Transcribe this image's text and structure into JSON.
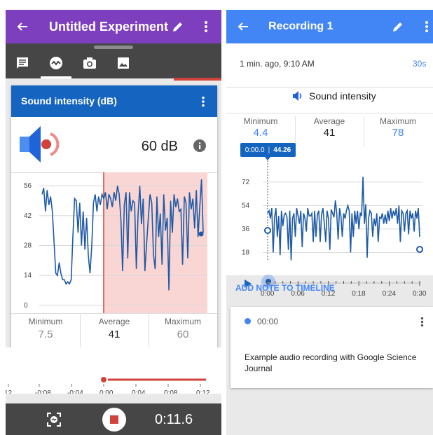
{
  "left_panel": {
    "title": "Untitled Experiment",
    "card": {
      "title": "Sound intensity (dB)",
      "current_value": "60 dB",
      "stats": [
        {
          "label": "Minimum",
          "value": "7.5"
        },
        {
          "label": "Average",
          "value": "41"
        },
        {
          "label": "Maximum",
          "value": "60"
        }
      ]
    },
    "timeline_ticks": [
      "12",
      "-0:08",
      "-0:04",
      "0:00",
      "0:04",
      "0:08",
      "0:12"
    ],
    "timer": "0:11.6",
    "colors": {
      "app_bar": "#7e3fbf",
      "card_header": "#1565c0",
      "record": "#d2423c"
    }
  },
  "right_panel": {
    "title": "Recording 1",
    "timestamp": "1 min. ago, 9:10 AM",
    "duration": "30s",
    "sensor_name": "Sound intensity",
    "stats": [
      {
        "label": "Minimum",
        "value": "4.4"
      },
      {
        "label": "Average",
        "value": "41"
      },
      {
        "label": "Maximum",
        "value": "78"
      }
    ],
    "tooltip": {
      "time": "0:00.0",
      "value": "44.26"
    },
    "x_ticks": [
      "0:00",
      "0:06",
      "0:12",
      "0:18",
      "0:24",
      "0:30"
    ],
    "add_note": "ADD NOTE TO TIMELINE",
    "note": {
      "time": "00:00",
      "text": "Example audio recording with Google Science Journal"
    },
    "colors": {
      "app_bar": "#4285f4",
      "series": "#1f5aa6"
    }
  },
  "chart_data": [
    {
      "type": "line",
      "yticks": [
        56,
        42,
        28,
        14,
        0
      ],
      "ylim": [
        -4,
        61
      ],
      "series": [
        {
          "values": [
            52,
            55,
            44,
            54,
            47,
            51,
            44,
            30,
            15,
            14,
            20,
            15,
            12,
            12,
            10,
            11,
            10,
            12,
            32,
            50,
            49,
            34,
            48,
            28,
            44,
            26,
            41,
            23,
            15,
            28,
            48,
            52,
            44,
            51,
            47,
            52,
            50,
            53,
            45,
            52,
            50,
            46,
            53,
            49,
            56,
            52,
            40,
            16,
            47,
            53,
            22,
            53,
            44,
            49,
            48,
            17,
            42,
            56,
            38,
            50,
            16,
            29,
            41,
            52,
            48,
            24,
            17,
            51,
            32,
            43,
            19,
            52,
            35,
            41,
            7,
            49,
            34,
            52,
            46,
            50,
            44,
            45,
            19,
            51,
            48,
            22,
            53,
            45,
            50,
            36,
            54,
            32,
            46,
            59,
            34
          ]
        }
      ]
    },
    {
      "type": "line",
      "x_range_seconds": [
        0,
        30
      ],
      "yticks": [
        72,
        54,
        36,
        18
      ],
      "ylim": [
        0,
        88
      ],
      "series": [
        {
          "values": [
            48,
            50,
            44,
            52,
            18,
            45,
            52,
            30,
            46,
            16,
            50,
            38,
            47,
            48,
            45,
            20,
            50,
            12,
            44,
            48,
            30,
            52,
            46,
            40,
            50,
            22,
            48,
            44,
            34,
            52,
            46,
            46,
            48,
            26,
            50,
            30,
            47,
            50,
            26,
            47,
            52,
            40,
            26,
            50,
            44,
            20,
            51,
            48,
            45,
            58,
            48,
            28,
            52,
            46,
            30,
            48,
            44,
            50,
            54,
            50,
            18,
            48,
            30,
            50,
            40,
            50,
            36,
            48,
            46,
            76,
            40,
            55,
            14,
            44,
            50,
            48,
            30,
            44,
            38,
            48,
            26,
            45,
            44,
            48,
            40,
            47,
            40,
            50,
            42,
            52,
            44,
            50,
            46,
            52,
            40,
            54,
            26,
            50,
            48,
            34,
            48,
            50,
            32,
            50,
            44,
            48,
            34,
            50,
            44,
            52,
            30
          ]
        }
      ]
    }
  ]
}
